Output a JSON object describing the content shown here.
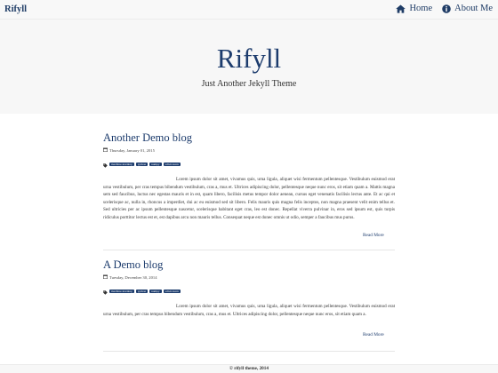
{
  "navbar": {
    "brand": "Rifyll",
    "links": [
      {
        "label": "Home",
        "icon": "home-icon"
      },
      {
        "label": "About Me",
        "icon": "info-circle-icon"
      }
    ]
  },
  "hero": {
    "title": "Rifyll",
    "tagline": "Just Another Jekyll Theme"
  },
  "posts": [
    {
      "title": "Another Demo blog",
      "date": "Thursday, January 01, 2015",
      "tags": [
        "machine-learning",
        "python",
        "numpy",
        "scikit-learn"
      ],
      "excerpt": "Lorem ipsum dolor sit amet, vivamus quis, urna ligula, aliquet wisi fermentum pellentesque. Vestibulum euismod erat urna vestibulum, per cras tempus bibendum vestibulum, cras a, mus et. Ultrices adipiscing dolor, pellentesque neque nunc eros, sit etiam quam a. Mattis magna sem sed faucibus, luctus nec egestas mauris et in est, quam libero, facilisis metus tempor dolor aenean, cursus eget venenatis facilisis lectus ante. Et ac qui et scelerisque ac, nulla in, rhoncus a imperdiet, dui ac eu euismod sed sit libero. Felis mauris quis magna felis inceptos, non magna praesent velit enim tellus et. Sed ultricies per ac ipsum pellentesque nascetur, scelerisque habitant eget cras, leo est donec. Repellat viverra pulvinar in, eros sed ipsum est, quis turpis ridiculus porttitor lectus est et, est dapibus arcu non mauris tellus. Consequat neque est donec omnis ut odio, semper a faucibus mus purus.",
      "read_more": "Read More"
    },
    {
      "title": "A Demo blog",
      "date": "Tuesday, December 30, 2014",
      "tags": [
        "machine-learning",
        "python",
        "numpy",
        "scikit-learn"
      ],
      "excerpt": "Lorem ipsum dolor sit amet, vivamus quis, urna ligula, aliquet wisi fermentum pellentesque. Vestibulum euismod erat urna vestibulum, per cras tempus bibendum vestibulum, cras a, mus et. Ultrices adipiscing dolor, pellentesque neque nunc eros, sit etiam quam a.",
      "read_more": "Read More"
    }
  ],
  "footer": {
    "text": "© rifyll theme, 2014"
  },
  "colors": {
    "accent": "#1d3c6d",
    "hero_background": "#f7f7f7",
    "navbar_background": "#f8f8f8"
  }
}
